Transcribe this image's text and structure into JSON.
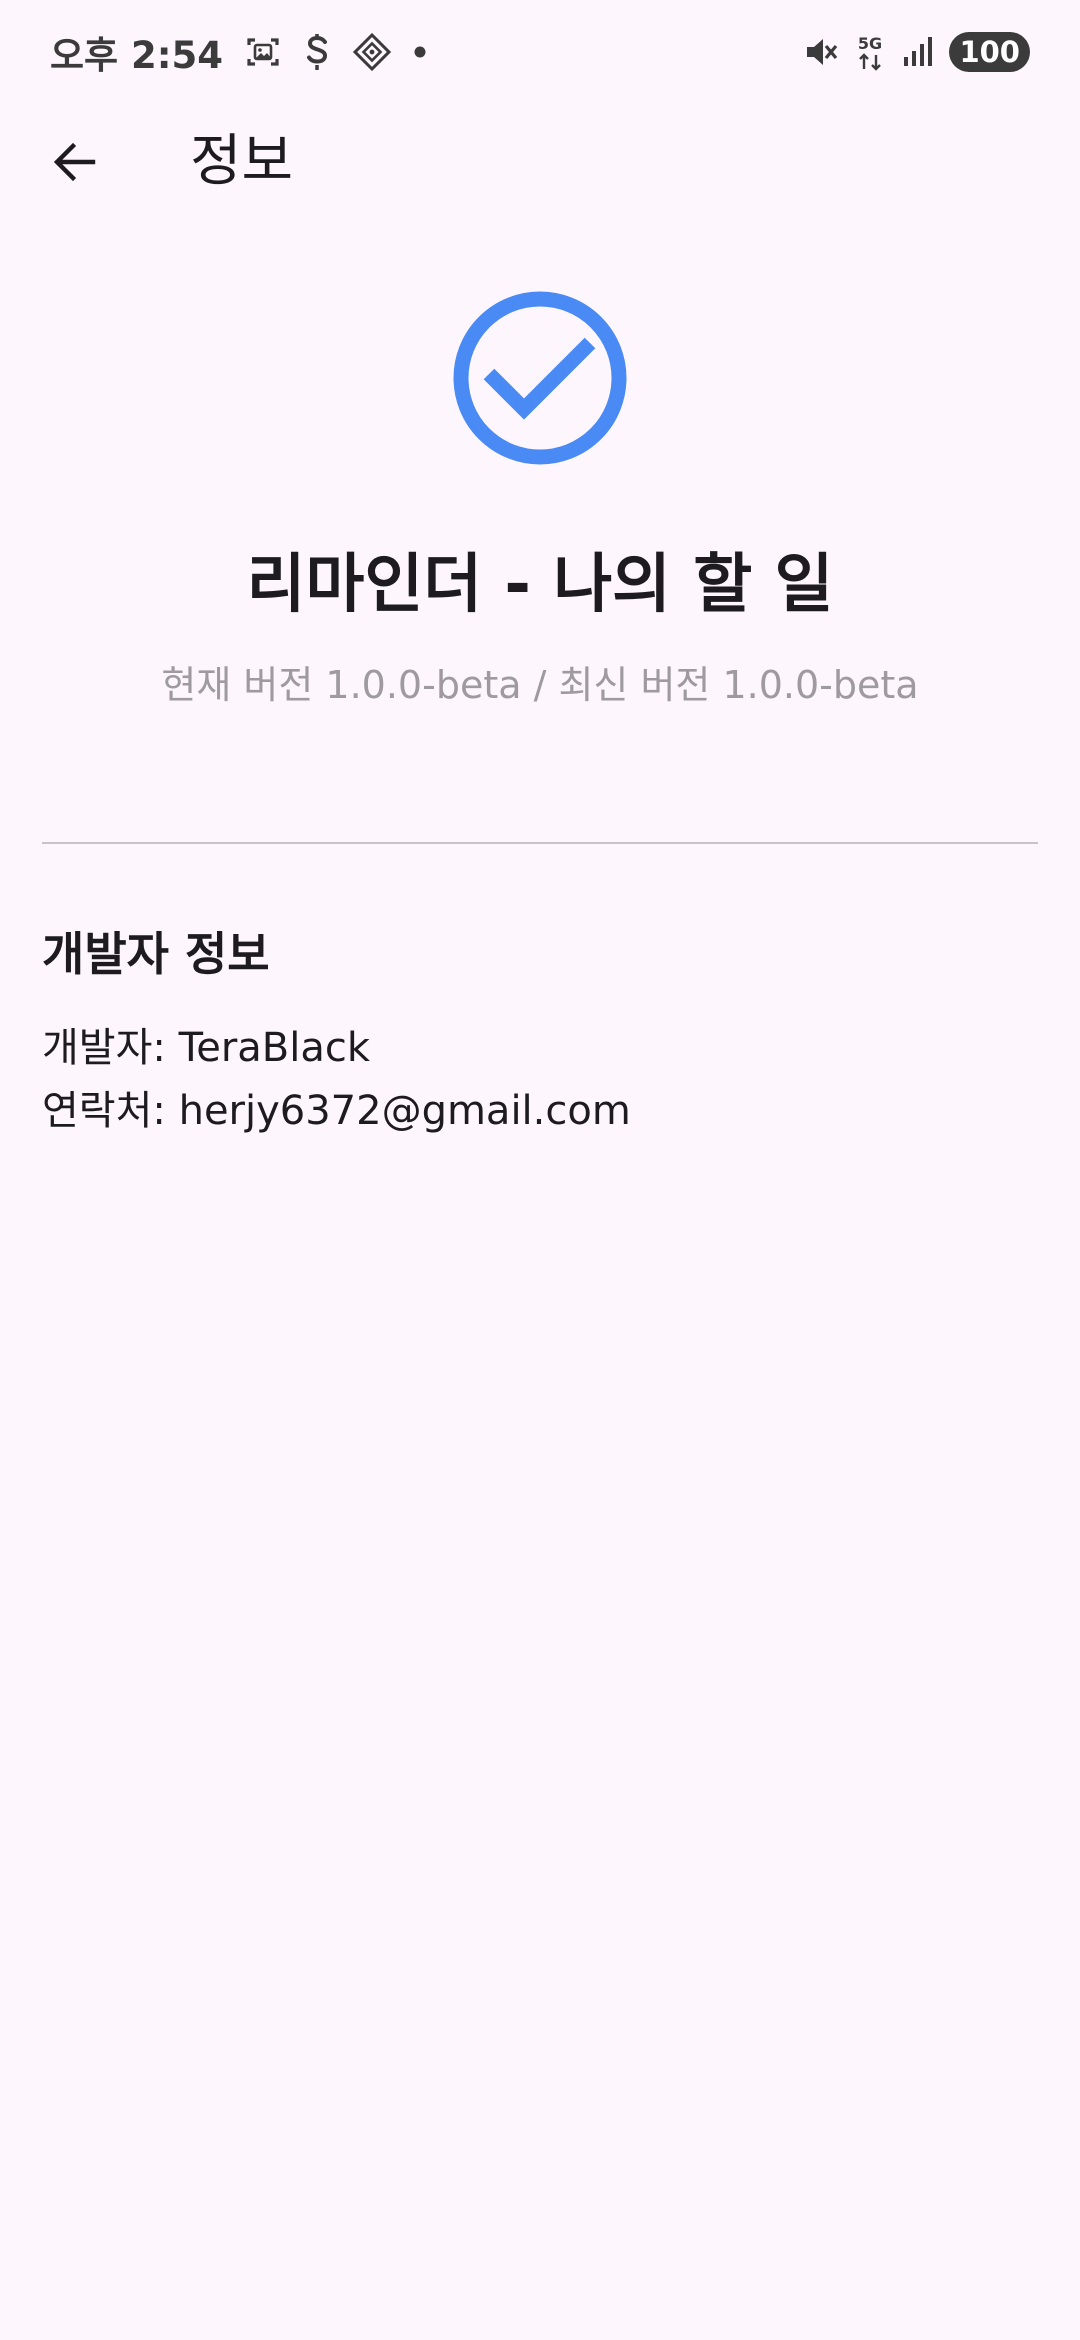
{
  "status_bar": {
    "time": "오후 2:54",
    "network": "5G",
    "battery": "100",
    "icons": [
      "screenshot-icon",
      "s-app-icon",
      "diamond-app-icon",
      "dot-icon",
      "mute-icon",
      "5g-icon",
      "signal-icon",
      "battery-icon"
    ]
  },
  "app_bar": {
    "title": "정보",
    "back_icon": "arrow-back-icon"
  },
  "header": {
    "app_name": "리마인더 - 나의 할 일",
    "version_text": "현재 버전 1.0.0-beta / 최신 버전 1.0.0-beta",
    "logo_icon": "check-circle-icon",
    "accent_color": "#4a8af4"
  },
  "developer_section": {
    "title": "개발자 정보",
    "developer_line": "개발자: TeraBlack",
    "contact_line": "연락처: herjy6372@gmail.com"
  }
}
